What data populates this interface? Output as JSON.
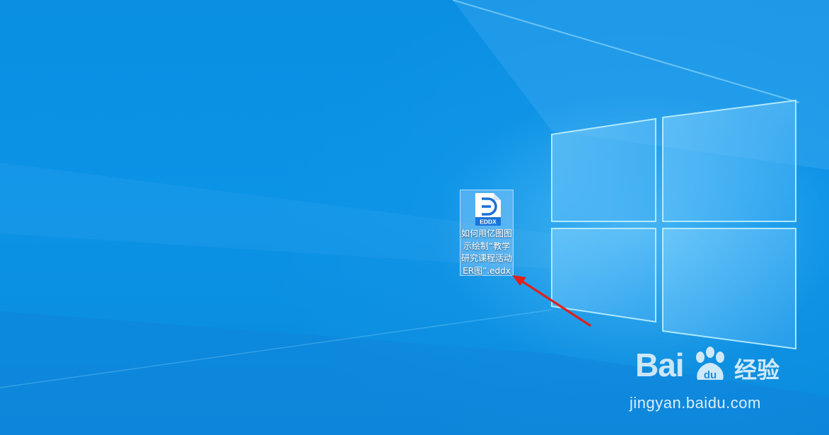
{
  "desktop": {
    "background_color": "#0b92e4",
    "file": {
      "badge": "EDDX",
      "name": "如何用亿图图示绘制“教学研究课程活动ER图”.eddx",
      "badge_color": "#1a73d9"
    },
    "annotation_arrow_color": "#e0201b"
  },
  "watermark": {
    "brand_left": "Bai",
    "brand_right": "经验",
    "url": "jingyan.baidu.com"
  }
}
